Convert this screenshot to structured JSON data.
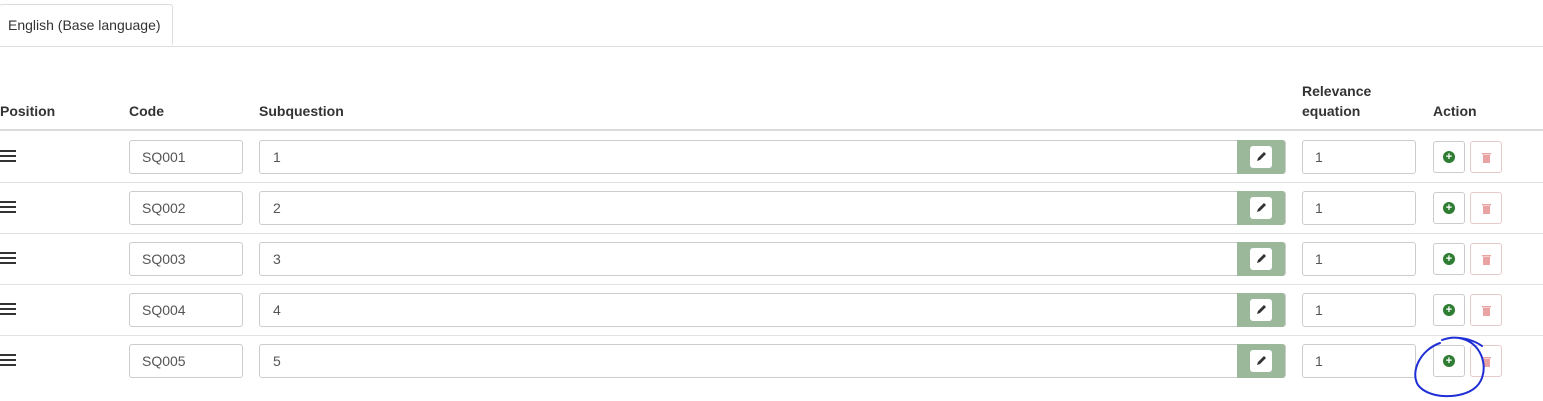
{
  "tabs": [
    {
      "label": "English (Base language)"
    }
  ],
  "table": {
    "headers": {
      "position": "Position",
      "code": "Code",
      "subquestion": "Subquestion",
      "relevance_line1": "Relevance",
      "relevance_line2": "equation",
      "action": "Action"
    },
    "rows": [
      {
        "code": "SQ001",
        "subquestion": "1",
        "relevance": "1"
      },
      {
        "code": "SQ002",
        "subquestion": "2",
        "relevance": "1"
      },
      {
        "code": "SQ003",
        "subquestion": "3",
        "relevance": "1"
      },
      {
        "code": "SQ004",
        "subquestion": "4",
        "relevance": "1"
      },
      {
        "code": "SQ005",
        "subquestion": "5",
        "relevance": "1"
      }
    ]
  },
  "icons": {
    "drag": "drag-handle-icon",
    "edit": "pencil-icon",
    "add": "plus-circle-icon",
    "delete": "trash-icon"
  },
  "colors": {
    "edit_button": "#9bb89b",
    "add_icon": "#2e7d32",
    "delete_icon": "#e9a3a3",
    "annotation": "#1f2fd6"
  }
}
